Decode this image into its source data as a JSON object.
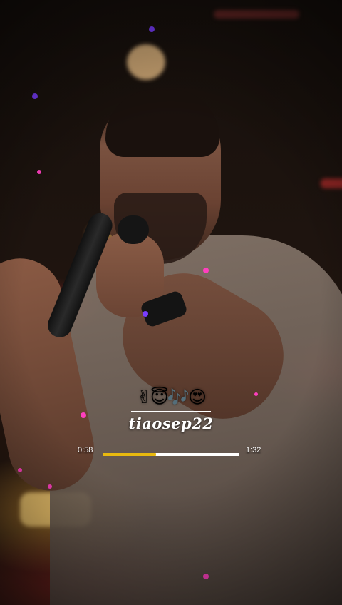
{
  "video": {
    "emoji_line": "✌😇🎶😍",
    "handle": "tiaosep22"
  },
  "player": {
    "current_time": "0:58",
    "total_time": "1:32",
    "progress": 0.39,
    "fill_color": "#e8b90f",
    "track_color": "#ffffff"
  },
  "scene": {
    "particle_colors": [
      "#ff3fbf",
      "#7a3dff",
      "#e8b90f"
    ]
  }
}
